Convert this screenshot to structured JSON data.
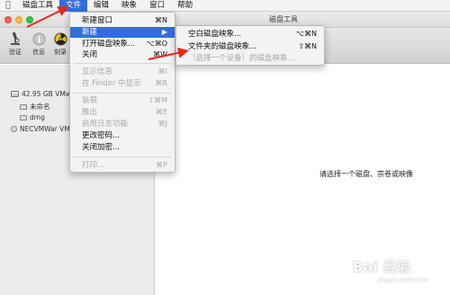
{
  "menubar": {
    "items": [
      "磁盘工具",
      "文件",
      "编辑",
      "映象",
      "窗口",
      "帮助"
    ],
    "active_index": 1
  },
  "window": {
    "title": "磁盘工具"
  },
  "toolbar": {
    "items": [
      {
        "label": "验证",
        "icon": "microscope-icon"
      },
      {
        "label": "信息",
        "icon": "info-icon"
      },
      {
        "label": "刻录",
        "icon": "burn-icon"
      }
    ]
  },
  "sidebar": {
    "items": [
      {
        "label": "42.95 GB VMw",
        "kind": "disk"
      },
      {
        "label": "未命名",
        "kind": "volume"
      },
      {
        "label": "dmg",
        "kind": "volume"
      },
      {
        "label": "NECVMWar VM",
        "kind": "disk"
      }
    ]
  },
  "file_menu": {
    "items": [
      {
        "label": "新建窗口",
        "shortcut": "⌘N",
        "disabled": false
      },
      {
        "label": "新建",
        "shortcut": "▶",
        "disabled": false,
        "highlighted": true
      },
      {
        "label": "打开磁盘映象...",
        "shortcut": "⌥⌘O",
        "disabled": false
      },
      {
        "label": "关闭",
        "shortcut": "⌘W",
        "disabled": false
      },
      {
        "label": "显示信息",
        "shortcut": "⌘I",
        "disabled": true
      },
      {
        "label": "在 Finder 中显示",
        "shortcut": "⌘R",
        "disabled": true
      },
      {
        "label": "装载",
        "shortcut": "⇧⌘M",
        "disabled": true
      },
      {
        "label": "推出",
        "shortcut": "⌘E",
        "disabled": true
      },
      {
        "label": "启用日志功能",
        "shortcut": "⌘J",
        "disabled": true
      },
      {
        "label": "更改密码...",
        "shortcut": "",
        "disabled": false
      },
      {
        "label": "关闭加密...",
        "shortcut": "",
        "disabled": false
      },
      {
        "label": "打印...",
        "shortcut": "⌘P",
        "disabled": true
      }
    ]
  },
  "new_submenu": {
    "items": [
      {
        "label": "空白磁盘映象...",
        "shortcut": "⌥⌘N",
        "disabled": false
      },
      {
        "label": "文件夹的磁盘映象...",
        "shortcut": "⇧⌘N",
        "disabled": false
      },
      {
        "label": "（选择一个设备）的磁盘映象...",
        "shortcut": "",
        "disabled": true
      }
    ]
  },
  "main": {
    "message": "请选择一个磁盘、宗卷或映像"
  },
  "watermark": {
    "text": "Bai 经验",
    "sub": "jingyan.baidu.com"
  }
}
